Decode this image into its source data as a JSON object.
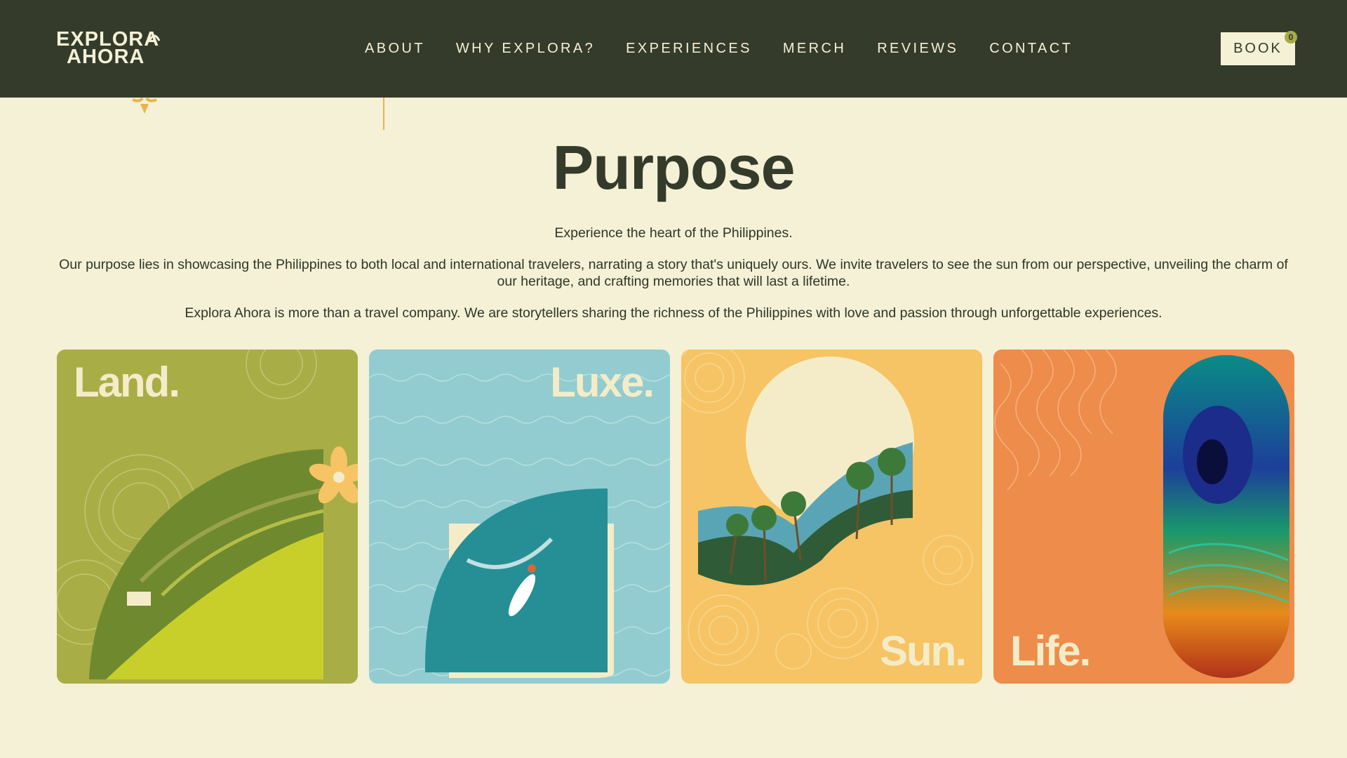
{
  "brand": {
    "logo_line1": "EXPLORA",
    "logo_line2": "AHORA"
  },
  "nav": {
    "items": [
      {
        "label": "ABOUT"
      },
      {
        "label": "WHY EXPLORA?"
      },
      {
        "label": "EXPERIENCES"
      },
      {
        "label": "MERCH"
      },
      {
        "label": "REVIEWS"
      },
      {
        "label": "CONTACT"
      }
    ],
    "book_label": "BOOK",
    "cart_count": "0"
  },
  "purpose": {
    "title": "Purpose",
    "subtitle": "Experience the heart of the Philippines.",
    "paragraph1": "Our purpose lies in showcasing the Philippines to both local and international travelers, narrating a story that's uniquely ours. We invite travelers to see the sun from our perspective, unveiling the charm of our heritage, and crafting memories that will last a lifetime.",
    "paragraph2": "Explora Ahora is more than a travel company. We are storytellers sharing the richness of the Philippines with love and passion through unforgettable experiences."
  },
  "cards": [
    {
      "label": "Land.",
      "color": "#a9ad46"
    },
    {
      "label": "Luxe.",
      "color": "#92ccd0"
    },
    {
      "label": "Sun.",
      "color": "#f6c465"
    },
    {
      "label": "Life.",
      "color": "#ee8c4b"
    }
  ],
  "colors": {
    "header": "#353b2b",
    "page_bg": "#f4f1d6",
    "accent_yellow": "#e9b54a"
  }
}
